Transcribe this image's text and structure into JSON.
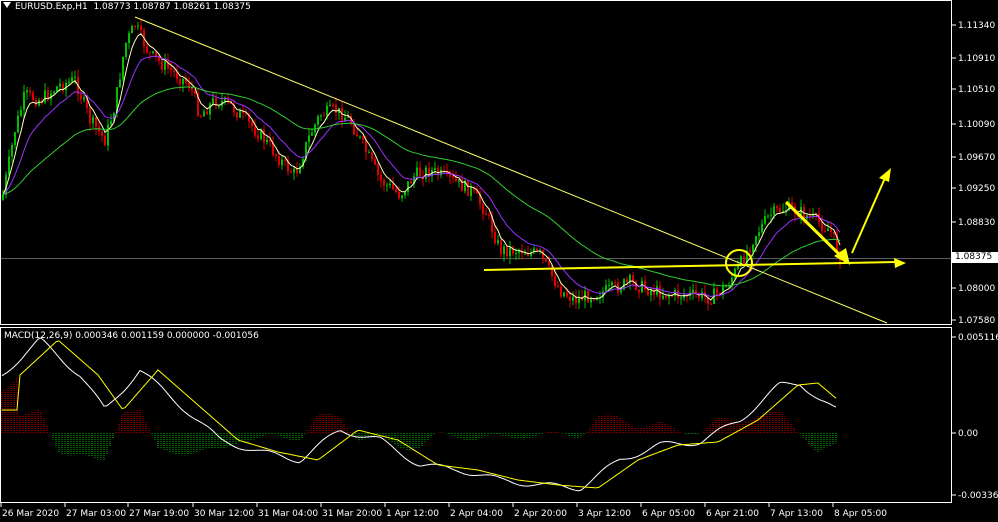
{
  "header": {
    "symbol": "EURUSD.Exp,H1",
    "ohlc": "1.08773 1.08787 1.08261 1.08375"
  },
  "price_axis": {
    "ticks": [
      "1.11340",
      "1.10910",
      "1.10510",
      "1.10090",
      "1.09670",
      "1.09250",
      "1.08830",
      "1.08000",
      "1.07580"
    ],
    "current_price": "1.08375"
  },
  "macd": {
    "label": "MACD(12,26,9) 0.000346 0.001159 0.000000 -0.001056",
    "ticks": [
      "0.005116",
      "0.00",
      "-0.003365"
    ]
  },
  "time_axis": {
    "labels": [
      "26 Mar 2020",
      "27 Mar 03:00",
      "27 Mar 19:00",
      "30 Mar 12:00",
      "31 Mar 04:00",
      "31 Mar 20:00",
      "1 Apr 12:00",
      "2 Apr 04:00",
      "2 Apr 20:00",
      "3 Apr 12:00",
      "6 Apr 05:00",
      "6 Apr 21:00",
      "7 Apr 13:00",
      "8 Apr 05:00"
    ]
  },
  "colors": {
    "background": "#000000",
    "bull": "#00c000",
    "bear": "#e00000",
    "annotation": "#ffff00",
    "ma_fast": "#ffffc0",
    "ma_mid": "#9b30ff",
    "ma_slow": "#32cd32",
    "trendline": "#ffff66",
    "grid": "#ffffff"
  }
}
